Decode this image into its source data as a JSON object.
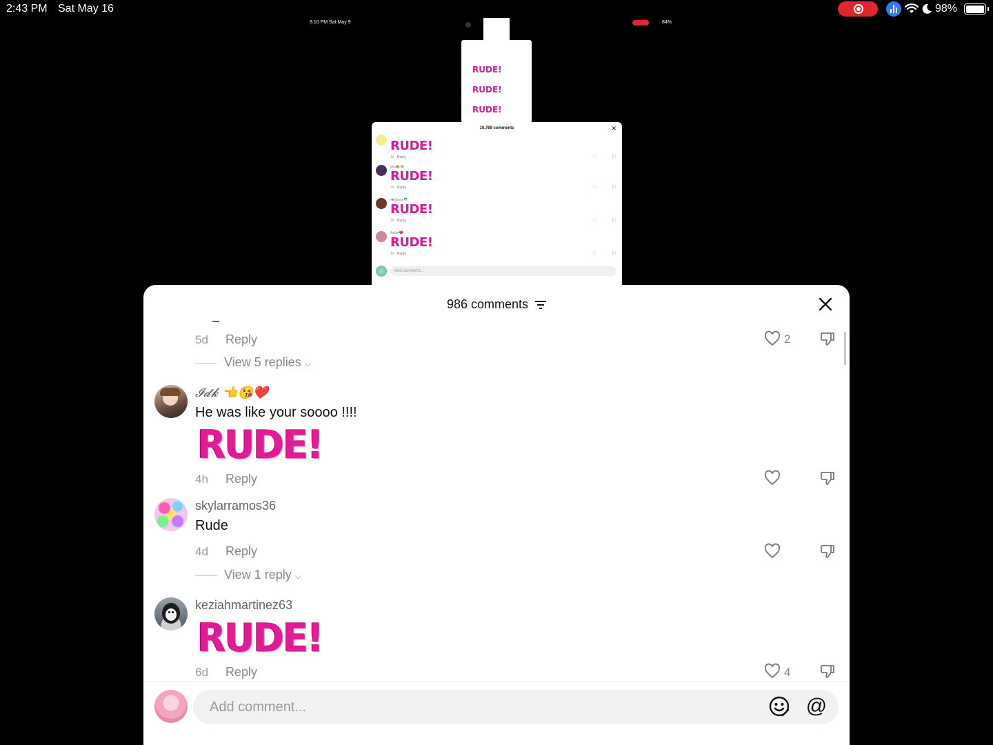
{
  "status_bar": {
    "time": "2:43 PM",
    "date": "Sat May 16",
    "battery_percent": "98%",
    "battery_level": 0.98,
    "recording_color": "#e0262b"
  },
  "background_recording": {
    "status_time": "8:10 PM  Sat May 9",
    "status_battery": "84%",
    "panel_title": "10,769 comments",
    "rows": [
      {
        "name": "",
        "sticker": "RUDE!",
        "age": "1h",
        "reply": "Reply",
        "avatar_color": "#f3ef8a"
      },
      {
        "name": "jojo🙈🐵",
        "sticker": "RUDE!",
        "age": "2h",
        "reply": "Reply",
        "avatar_color": "#4a2e5e"
      },
      {
        "name": "🐳𝒥𝒶𝓃𝒾𝑒🐬.",
        "sticker": "RUDE!",
        "age": "2h",
        "reply": "Reply",
        "avatar_color": "#6b3a2a"
      },
      {
        "name": "Addie❤️",
        "sticker": "RUDE!",
        "age": "1h",
        "reply": "Reply",
        "avatar_color": "#c98a9a"
      }
    ],
    "input_placeholder": "Add comment...",
    "small_panel_stickers": [
      "RUDE!",
      "RUDE!",
      "RUDE!"
    ]
  },
  "sheet": {
    "title": "986 comments",
    "close_icon": "close-icon",
    "filter_icon": "filter-icon"
  },
  "comments": [
    {
      "username": "",
      "text": "",
      "sticker": "",
      "age": "5d",
      "reply_label": "Reply",
      "likes": "2",
      "view_replies": "View 5 replies"
    },
    {
      "username": "𝓘𝓭𝓴 👈😘❤️",
      "text": "He was like your soooo !!!!",
      "sticker": "RUDE!",
      "age": "4h",
      "reply_label": "Reply",
      "likes": "",
      "view_replies": ""
    },
    {
      "username": "skylarramos36",
      "text": "Rude",
      "sticker": "",
      "age": "4d",
      "reply_label": "Reply",
      "likes": "",
      "view_replies": "View 1 reply"
    },
    {
      "username": "keziahmartinez63",
      "text": "",
      "sticker": "RUDE!",
      "age": "6d",
      "reply_label": "Reply",
      "likes": "4",
      "view_replies": ""
    }
  ],
  "footer": {
    "placeholder": "Add comment...",
    "emoji_icon": "emoji-icon",
    "mention_label": "@"
  },
  "colors": {
    "sticker_pink": "#e11b94",
    "sheet_bg": "#ffffff",
    "page_bg": "#000000"
  }
}
